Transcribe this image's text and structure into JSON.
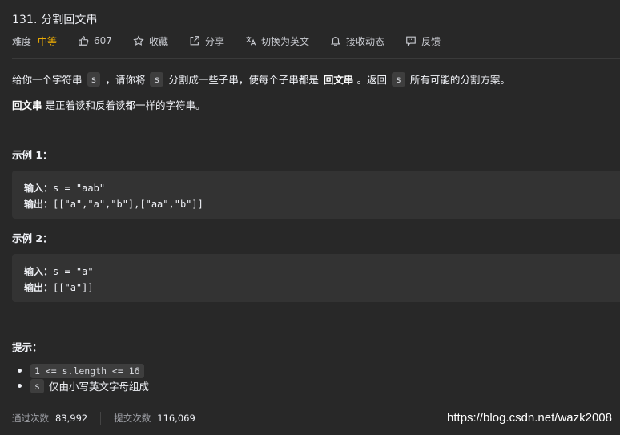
{
  "problem": {
    "title": "131. 分割回文串"
  },
  "meta": {
    "difficulty_label": "难度",
    "difficulty": "中等",
    "likes": "607",
    "favorite": "收藏",
    "share": "分享",
    "switch_lang": "切换为英文",
    "notify": "接收动态",
    "feedback": "反馈"
  },
  "description": {
    "p1_a": "给你一个字符串",
    "p1_code1": "s",
    "p1_b": "，请你将",
    "p1_code2": "s",
    "p1_c": "分割成一些子串，使每个子串都是",
    "p1_bold": "回文串",
    "p1_d": "。返回",
    "p1_code3": "s",
    "p1_e": "所有可能的分割方案。",
    "p2_bold": "回文串",
    "p2_rest": "是正着读和反着读都一样的字符串。"
  },
  "examples": [
    {
      "title": "示例 1：",
      "input_label": "输入：",
      "input_value": "s = \"aab\"",
      "output_label": "输出：",
      "output_value": "[[\"a\",\"a\",\"b\"],[\"aa\",\"b\"]]"
    },
    {
      "title": "示例 2：",
      "input_label": "输入：",
      "input_value": "s = \"a\"",
      "output_label": "输出：",
      "output_value": "[[\"a\"]]"
    }
  ],
  "hints": {
    "title": "提示：",
    "item1_code": "1 <= s.length <= 16",
    "item2_code": "s",
    "item2_text": "仅由小写英文字母组成"
  },
  "stats": {
    "accepted_label": "通过次数",
    "accepted_value": "83,992",
    "submissions_label": "提交次数",
    "submissions_value": "116,069"
  },
  "watermark": "https://blog.csdn.net/wazk2008"
}
